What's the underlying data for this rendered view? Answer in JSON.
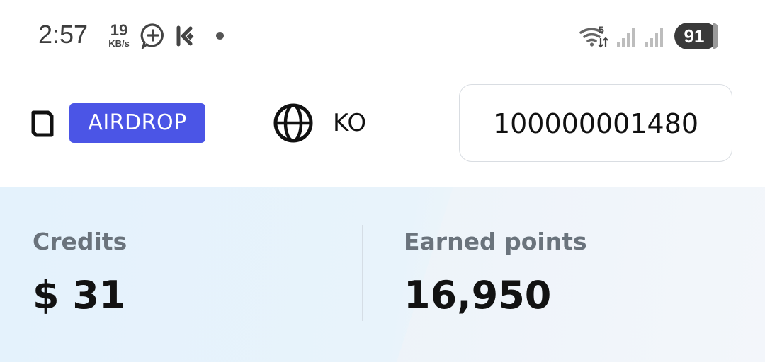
{
  "status_bar": {
    "time": "2:57",
    "net_speed_value": "19",
    "net_speed_unit": "KB/s",
    "wifi_badge": "5",
    "battery": "91",
    "icons": [
      "chat-plus-icon",
      "kucoin-logo-icon",
      "notification-dot",
      "wifi-icon",
      "signal-bars-icon",
      "signal-bars-icon",
      "battery-icon"
    ]
  },
  "header": {
    "logo_icon": "bracket-logo-icon",
    "badge_label": "AIRDROP",
    "language_icon": "globe-icon",
    "language_code": "KO",
    "account_id": "100000001480"
  },
  "stats": {
    "credits_label": "Credits",
    "credits_value": "$ 31",
    "points_label": "Earned points",
    "points_value": "16,950"
  },
  "colors": {
    "badge_bg": "#4b55e6",
    "stats_bg": "#e6f2fb",
    "label_gray": "#6a737c"
  }
}
